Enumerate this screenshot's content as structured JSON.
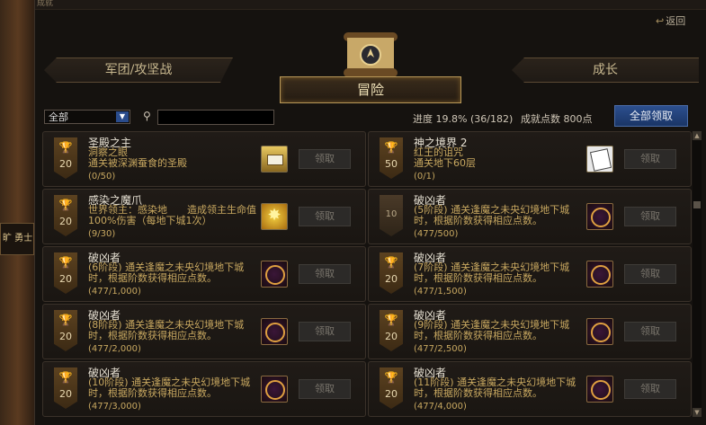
{
  "window": {
    "title": "成就"
  },
  "back_label": "返回",
  "tabs": {
    "left": "军团/攻坚战",
    "active": "冒险",
    "right": "成长"
  },
  "filter": {
    "selected": "全部"
  },
  "search": {
    "placeholder": ""
  },
  "progress": {
    "label": "进度",
    "percent": "19.8%",
    "count": "(36/182)"
  },
  "points": {
    "label": "成就点数",
    "value": "800点"
  },
  "claim_all_label": "全部领取",
  "claim_label": "领取",
  "side_sign": "旷 勇士",
  "cards": [
    {
      "title": "圣殿之主",
      "desc": "洞察之眼\n通关被深渊蚕食的圣殿",
      "progress": "(0/50)",
      "medal": "20",
      "icon": "chest-icon"
    },
    {
      "title": "神之境界 2",
      "desc": "红王的诅咒\n通关地下60层",
      "progress": "(0/1)",
      "medal": "50",
      "icon": "paper-icon"
    },
    {
      "title": "感染之魔爪",
      "desc": "世界领主：感染地　　造成领主生命值100%伤害（每地下城1次）",
      "progress": "(9/30)",
      "medal": "20",
      "icon": "star-icon"
    },
    {
      "title": "破凶者",
      "desc": "(5阶段) 通关逢魔之未央幻境地下城时，根据阶数获得相应点数。",
      "progress": "(477/500)",
      "medal": "10",
      "icon": "symbol-icon"
    },
    {
      "title": "破凶者",
      "desc": "(6阶段) 通关逢魔之未央幻境地下城时，根据阶数获得相应点数。",
      "progress": "(477/1,000)",
      "medal": "20",
      "icon": "symbol-icon"
    },
    {
      "title": "破凶者",
      "desc": "(7阶段) 通关逢魔之未央幻境地下城时，根据阶数获得相应点数。",
      "progress": "(477/1,500)",
      "medal": "20",
      "icon": "symbol-icon"
    },
    {
      "title": "破凶者",
      "desc": "(8阶段) 通关逢魔之未央幻境地下城时，根据阶数获得相应点数。",
      "progress": "(477/2,000)",
      "medal": "20",
      "icon": "symbol-icon"
    },
    {
      "title": "破凶者",
      "desc": "(9阶段) 通关逢魔之未央幻境地下城时，根据阶数获得相应点数。",
      "progress": "(477/2,500)",
      "medal": "20",
      "icon": "symbol-icon"
    },
    {
      "title": "破凶者",
      "desc": "(10阶段) 通关逢魔之未央幻境地下城时，根据阶数获得相应点数。",
      "progress": "(477/3,000)",
      "medal": "20",
      "icon": "symbol-icon"
    },
    {
      "title": "破凶者",
      "desc": "(11阶段) 通关逢魔之未央幻境地下城时，根据阶数获得相应点数。",
      "progress": "(477/4,000)",
      "medal": "20",
      "icon": "symbol-icon"
    }
  ]
}
